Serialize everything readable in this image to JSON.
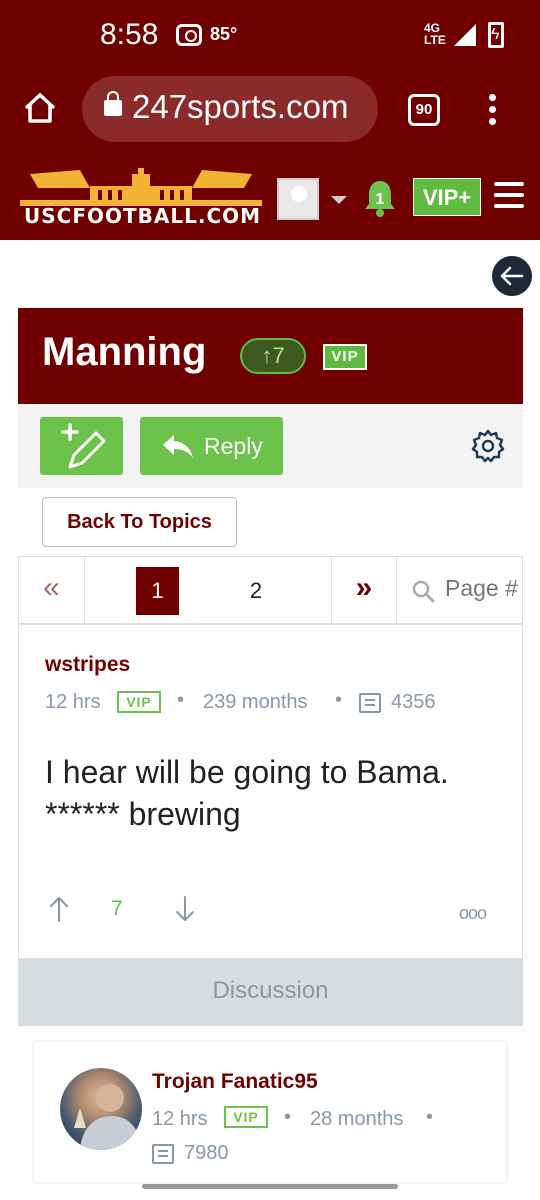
{
  "status_bar": {
    "time": "8:58",
    "temperature": "85°",
    "network": "4G\nLTE"
  },
  "browser": {
    "url": "247sports.com",
    "tab_count": "90"
  },
  "site": {
    "logo_text": "USCFOOTBALL.COM",
    "vip_plus_label": "VIP+",
    "notification_count": "1"
  },
  "thread": {
    "title": "Manning",
    "votes": "↑7",
    "vip_label": "VIP",
    "reply_label": "Reply",
    "back_label": "Back To Topics"
  },
  "pagination": {
    "prev": "«",
    "pages": [
      "1",
      "2"
    ],
    "current_page": "1",
    "next": "»",
    "placeholder": "Page #"
  },
  "post": {
    "author": "wstripes",
    "time": "12 hrs",
    "vip_label": "VIP",
    "tenure": "239 months",
    "post_count": "4356",
    "body": "I hear will be going to Bama. ****** brewing",
    "votes": "7",
    "more": "ooo"
  },
  "discussion_label": "Discussion",
  "reply": {
    "author": "Trojan Fanatic95",
    "time": "12 hrs",
    "vip_label": "VIP",
    "tenure": "28 months",
    "post_count": "7980"
  },
  "colors": {
    "brand": "#700000",
    "accent_green": "#6cc24a",
    "meta_gray": "#8898a8"
  }
}
